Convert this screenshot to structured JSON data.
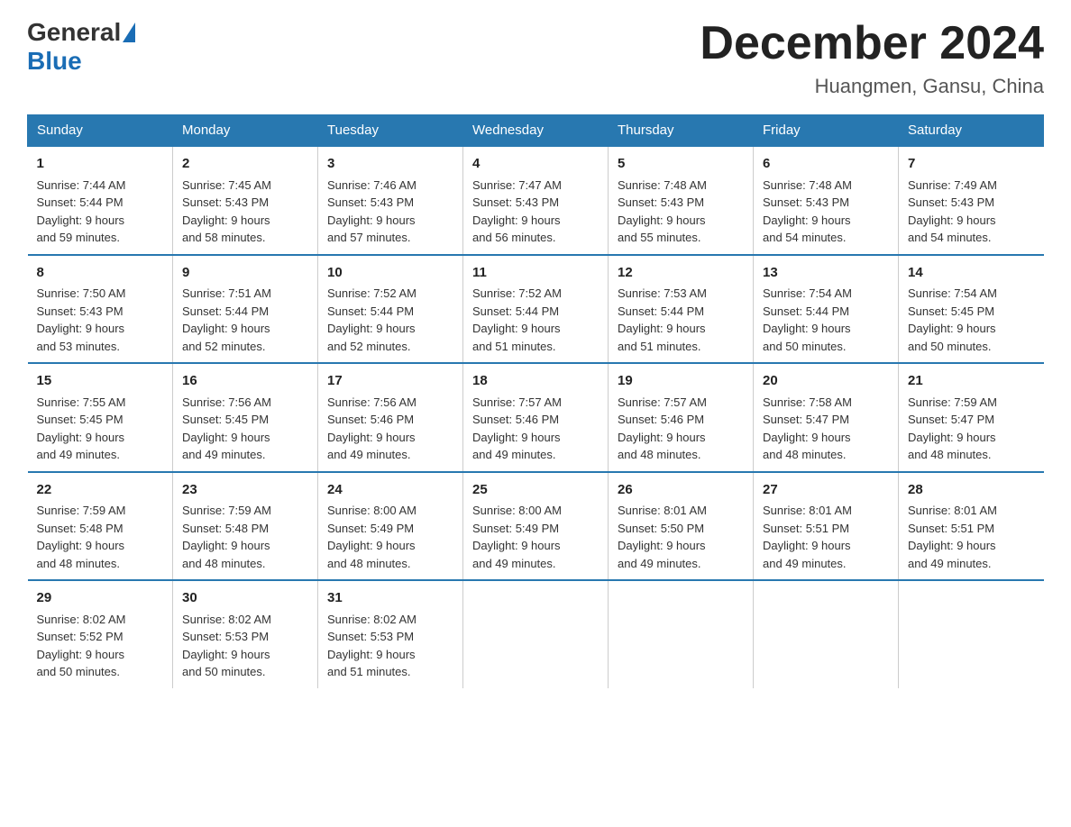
{
  "header": {
    "logo": {
      "general": "General",
      "blue": "Blue"
    },
    "title": "December 2024",
    "location": "Huangmen, Gansu, China"
  },
  "weekdays": [
    "Sunday",
    "Monday",
    "Tuesday",
    "Wednesday",
    "Thursday",
    "Friday",
    "Saturday"
  ],
  "weeks": [
    [
      {
        "day": "1",
        "sunrise": "7:44 AM",
        "sunset": "5:44 PM",
        "daylight": "9 hours and 59 minutes."
      },
      {
        "day": "2",
        "sunrise": "7:45 AM",
        "sunset": "5:43 PM",
        "daylight": "9 hours and 58 minutes."
      },
      {
        "day": "3",
        "sunrise": "7:46 AM",
        "sunset": "5:43 PM",
        "daylight": "9 hours and 57 minutes."
      },
      {
        "day": "4",
        "sunrise": "7:47 AM",
        "sunset": "5:43 PM",
        "daylight": "9 hours and 56 minutes."
      },
      {
        "day": "5",
        "sunrise": "7:48 AM",
        "sunset": "5:43 PM",
        "daylight": "9 hours and 55 minutes."
      },
      {
        "day": "6",
        "sunrise": "7:48 AM",
        "sunset": "5:43 PM",
        "daylight": "9 hours and 54 minutes."
      },
      {
        "day": "7",
        "sunrise": "7:49 AM",
        "sunset": "5:43 PM",
        "daylight": "9 hours and 54 minutes."
      }
    ],
    [
      {
        "day": "8",
        "sunrise": "7:50 AM",
        "sunset": "5:43 PM",
        "daylight": "9 hours and 53 minutes."
      },
      {
        "day": "9",
        "sunrise": "7:51 AM",
        "sunset": "5:44 PM",
        "daylight": "9 hours and 52 minutes."
      },
      {
        "day": "10",
        "sunrise": "7:52 AM",
        "sunset": "5:44 PM",
        "daylight": "9 hours and 52 minutes."
      },
      {
        "day": "11",
        "sunrise": "7:52 AM",
        "sunset": "5:44 PM",
        "daylight": "9 hours and 51 minutes."
      },
      {
        "day": "12",
        "sunrise": "7:53 AM",
        "sunset": "5:44 PM",
        "daylight": "9 hours and 51 minutes."
      },
      {
        "day": "13",
        "sunrise": "7:54 AM",
        "sunset": "5:44 PM",
        "daylight": "9 hours and 50 minutes."
      },
      {
        "day": "14",
        "sunrise": "7:54 AM",
        "sunset": "5:45 PM",
        "daylight": "9 hours and 50 minutes."
      }
    ],
    [
      {
        "day": "15",
        "sunrise": "7:55 AM",
        "sunset": "5:45 PM",
        "daylight": "9 hours and 49 minutes."
      },
      {
        "day": "16",
        "sunrise": "7:56 AM",
        "sunset": "5:45 PM",
        "daylight": "9 hours and 49 minutes."
      },
      {
        "day": "17",
        "sunrise": "7:56 AM",
        "sunset": "5:46 PM",
        "daylight": "9 hours and 49 minutes."
      },
      {
        "day": "18",
        "sunrise": "7:57 AM",
        "sunset": "5:46 PM",
        "daylight": "9 hours and 49 minutes."
      },
      {
        "day": "19",
        "sunrise": "7:57 AM",
        "sunset": "5:46 PM",
        "daylight": "9 hours and 48 minutes."
      },
      {
        "day": "20",
        "sunrise": "7:58 AM",
        "sunset": "5:47 PM",
        "daylight": "9 hours and 48 minutes."
      },
      {
        "day": "21",
        "sunrise": "7:59 AM",
        "sunset": "5:47 PM",
        "daylight": "9 hours and 48 minutes."
      }
    ],
    [
      {
        "day": "22",
        "sunrise": "7:59 AM",
        "sunset": "5:48 PM",
        "daylight": "9 hours and 48 minutes."
      },
      {
        "day": "23",
        "sunrise": "7:59 AM",
        "sunset": "5:48 PM",
        "daylight": "9 hours and 48 minutes."
      },
      {
        "day": "24",
        "sunrise": "8:00 AM",
        "sunset": "5:49 PM",
        "daylight": "9 hours and 48 minutes."
      },
      {
        "day": "25",
        "sunrise": "8:00 AM",
        "sunset": "5:49 PM",
        "daylight": "9 hours and 49 minutes."
      },
      {
        "day": "26",
        "sunrise": "8:01 AM",
        "sunset": "5:50 PM",
        "daylight": "9 hours and 49 minutes."
      },
      {
        "day": "27",
        "sunrise": "8:01 AM",
        "sunset": "5:51 PM",
        "daylight": "9 hours and 49 minutes."
      },
      {
        "day": "28",
        "sunrise": "8:01 AM",
        "sunset": "5:51 PM",
        "daylight": "9 hours and 49 minutes."
      }
    ],
    [
      {
        "day": "29",
        "sunrise": "8:02 AM",
        "sunset": "5:52 PM",
        "daylight": "9 hours and 50 minutes."
      },
      {
        "day": "30",
        "sunrise": "8:02 AM",
        "sunset": "5:53 PM",
        "daylight": "9 hours and 50 minutes."
      },
      {
        "day": "31",
        "sunrise": "8:02 AM",
        "sunset": "5:53 PM",
        "daylight": "9 hours and 51 minutes."
      },
      null,
      null,
      null,
      null
    ]
  ]
}
